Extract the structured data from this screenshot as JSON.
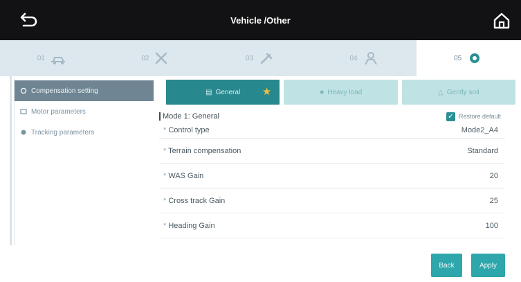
{
  "header": {
    "title": "Vehicle /Other",
    "back_icon": "back-icon",
    "home_icon": "home-icon"
  },
  "steps": [
    {
      "label": "01",
      "icon": "vehicle-icon",
      "active": false
    },
    {
      "label": "02",
      "icon": "wrench-icon",
      "active": false
    },
    {
      "label": "03",
      "icon": "tools-icon",
      "active": false
    },
    {
      "label": "04",
      "icon": "person-icon",
      "active": false
    },
    {
      "label": "05",
      "icon": "gear-icon",
      "active": true
    }
  ],
  "sidebar": {
    "items": [
      {
        "label": "Compensation setting",
        "active": true
      },
      {
        "label": "Motor parameters",
        "active": false
      },
      {
        "label": "Tracking parameters",
        "active": false
      }
    ]
  },
  "tabs": [
    {
      "label": "General",
      "active": true
    },
    {
      "label": "Heavy load",
      "active": false
    },
    {
      "label": "Gently soil",
      "active": false
    }
  ],
  "mode": {
    "label": "Mode 1: General",
    "restore_label": "Restore default"
  },
  "params": [
    {
      "name": "Control type",
      "value": "Mode2_A4"
    },
    {
      "name": "Terrain compensation",
      "value": "Standard"
    },
    {
      "name": "WAS Gain",
      "value": "20"
    },
    {
      "name": "Cross track Gain",
      "value": "25"
    },
    {
      "name": "Heading Gain",
      "value": "100"
    }
  ],
  "footer": {
    "back_label": "Back",
    "apply_label": "Apply"
  },
  "colors": {
    "accent": "#27888e",
    "button": "#2da7ab",
    "topbar": "#121214"
  }
}
